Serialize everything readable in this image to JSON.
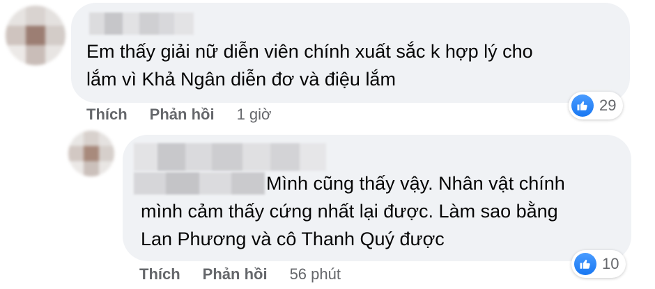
{
  "comments": [
    {
      "text_line1": "Em thấy giải nữ diễn viên chính xuất sắc k hợp lý cho",
      "text_line2": "lắm vì Khả Ngân diễn đơ và điệu lắm",
      "like_label": "Thích",
      "reply_label": "Phản hồi",
      "time": "1 giờ",
      "reaction_count": "29",
      "reaction_icon": "like-icon",
      "reaction_color": "#1877f2"
    },
    {
      "text_line1": "Mình cũng thấy vậy. Nhân vật chính",
      "text_line2": "mình cảm thấy cứng nhất lại được. Làm sao bằng",
      "text_line3": "Lan Phương và cô Thanh Quý được",
      "like_label": "Thích",
      "reply_label": "Phản hồi",
      "time": "56 phút",
      "reaction_count": "10",
      "reaction_icon": "like-icon",
      "reaction_color": "#1877f2"
    }
  ],
  "colors": {
    "bubble": "#f0f2f5",
    "secondary_text": "#65676b",
    "like_blue": "#1877f2"
  }
}
